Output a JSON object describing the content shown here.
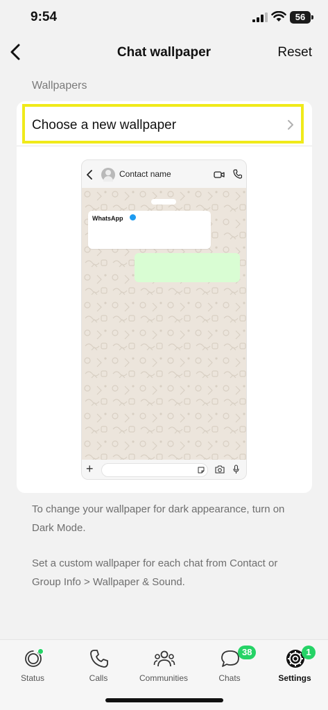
{
  "status_bar": {
    "time": "9:54",
    "battery": "56"
  },
  "nav": {
    "title": "Chat wallpaper",
    "reset_label": "Reset"
  },
  "section": {
    "label": "Wallpapers"
  },
  "wallpaper_row": {
    "label": "Choose a new wallpaper",
    "highlight_color": "#f0ea1a"
  },
  "preview": {
    "contact_name": "Contact name",
    "message_sender": "WhatsApp",
    "plus_symbol": "+"
  },
  "info": {
    "dark_mode_text": "To change your wallpaper for dark appearance, turn on Dark Mode.",
    "custom_text": "Set a custom wallpaper for each chat from Contact or Group Info > Wallpaper & Sound."
  },
  "tabs": [
    {
      "label": "Status",
      "icon": "status-icon"
    },
    {
      "label": "Calls",
      "icon": "phone-icon"
    },
    {
      "label": "Communities",
      "icon": "communities-icon"
    },
    {
      "label": "Chats",
      "icon": "chat-bubble-icon",
      "badge": "38"
    },
    {
      "label": "Settings",
      "icon": "gear-icon",
      "badge": "1",
      "active": true
    }
  ],
  "colors": {
    "accent_green": "#25d366",
    "outgoing_bubble": "#d9fdd3",
    "background": "#f2f2f2"
  }
}
